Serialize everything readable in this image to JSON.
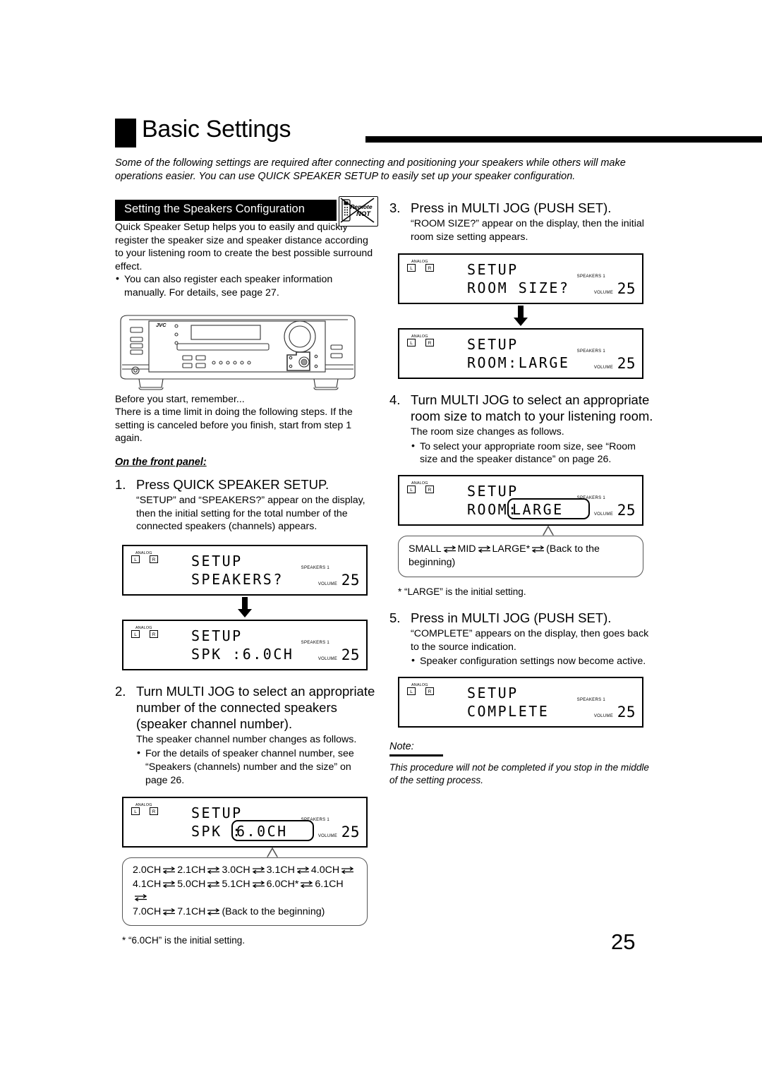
{
  "page": {
    "number": "25",
    "title": "Basic Settings",
    "intro": "Some of the following settings are required after connecting and positioning your speakers while others will make operations easier. You can use QUICK SPEAKER SETUP to easily set up your speaker configuration."
  },
  "section": {
    "heading": "Setting the Speakers Configuration",
    "badge_line1": "Remote",
    "badge_line2": "NOT",
    "intro": "Quick Speaker Setup helps you to easily and quickly register the speaker size and speaker distance according to your listening room to create the best possible surround effect.",
    "bullet": "You can also register each speaker information manually. For details, see page 27."
  },
  "before": {
    "heading": "Before you start, remember...",
    "text": "There is a time limit in doing the following steps. If the setting is canceled before you finish, start from step 1 again.",
    "front_panel": "On the front panel:"
  },
  "steps": {
    "s1": {
      "num": "1.",
      "title": "Press QUICK SPEAKER SETUP.",
      "detail": "“SETUP” and “SPEAKERS?” appear on the display, then the initial setting for the total number of the connected speakers (channels) appears."
    },
    "s2": {
      "num": "2.",
      "title": "Turn MULTI JOG to select an appropriate number of the connected speakers (speaker channel number).",
      "detail": "The speaker channel number changes as follows.",
      "bullet": "For the details of speaker channel number, see “Speakers (channels) number and the size” on page 26.",
      "footnote": "* “6.0CH” is the initial setting."
    },
    "s3": {
      "num": "3.",
      "title": "Press in MULTI JOG (PUSH SET).",
      "detail": "“ROOM SIZE?” appear on the display, then the initial room size setting appears."
    },
    "s4": {
      "num": "4.",
      "title": "Turn MULTI JOG to select an appropriate room size to match to your listening room.",
      "detail": "The room size changes as follows.",
      "bullet": "To select your appropriate room size, see “Room size and the speaker distance” on page 26.",
      "footnote": "* “LARGE” is the initial setting."
    },
    "s5": {
      "num": "5.",
      "title": "Press in MULTI JOG (PUSH SET).",
      "detail": "“COMPLETE” appears on the display, then goes back to the source indication.",
      "bullet": "Speaker configuration settings now become active."
    }
  },
  "displays": {
    "speakers_q": {
      "analog": "ANALOG",
      "l": "L",
      "r": "R",
      "line1": "SETUP",
      "line2": "SPEAKERS?",
      "speakers_label": "SPEAKERS 1",
      "volume_label": "VOLUME",
      "volume_value": "25"
    },
    "spk_60ch": {
      "analog": "ANALOG",
      "l": "L",
      "r": "R",
      "line1": "SETUP",
      "line2": "SPK :6.0CH",
      "speakers_label": "SPEAKERS 1",
      "volume_label": "VOLUME",
      "volume_value": "25"
    },
    "spk_60ch_hl": {
      "analog": "ANALOG",
      "l": "L",
      "r": "R",
      "line1": "SETUP",
      "line2_prefix": "SPK :",
      "line2_highlight": "6.0CH",
      "speakers_label": "SPEAKERS 1",
      "volume_label": "VOLUME",
      "volume_value": "25"
    },
    "room_size_q": {
      "analog": "ANALOG",
      "l": "L",
      "r": "R",
      "line1": "SETUP",
      "line2": "ROOM SIZE?",
      "speakers_label": "SPEAKERS 1",
      "volume_label": "VOLUME",
      "volume_value": "25"
    },
    "room_large": {
      "analog": "ANALOG",
      "l": "L",
      "r": "R",
      "line1": "SETUP",
      "line2": "ROOM:LARGE",
      "speakers_label": "SPEAKERS 1",
      "volume_label": "VOLUME",
      "volume_value": "25"
    },
    "room_large_hl": {
      "analog": "ANALOG",
      "l": "L",
      "r": "R",
      "line1": "SETUP",
      "line2_prefix": "ROOM:",
      "line2_highlight": "LARGE",
      "speakers_label": "SPEAKERS 1",
      "volume_label": "VOLUME",
      "volume_value": "25"
    },
    "complete": {
      "analog": "ANALOG",
      "l": "L",
      "r": "R",
      "line1": "SETUP",
      "line2": "COMPLETE",
      "speakers_label": "SPEAKERS 1",
      "volume_label": "VOLUME",
      "volume_value": "25"
    }
  },
  "sequences": {
    "channels": {
      "row1": [
        "2.0CH",
        "2.1CH",
        "3.0CH",
        "3.1CH",
        "4.0CH"
      ],
      "row2": [
        "4.1CH",
        "5.0CH",
        "5.1CH",
        "6.0CH*",
        "6.1CH"
      ],
      "row3": [
        "7.0CH",
        "7.1CH",
        "(Back to the beginning)"
      ]
    },
    "room": {
      "items": [
        "SMALL",
        "MID",
        "LARGE*",
        "(Back to the beginning)"
      ]
    }
  },
  "note": {
    "heading": "Note:",
    "body": "This procedure will not be completed if you stop in the middle of the setting process."
  },
  "receiver": {
    "brand": "JVC"
  }
}
